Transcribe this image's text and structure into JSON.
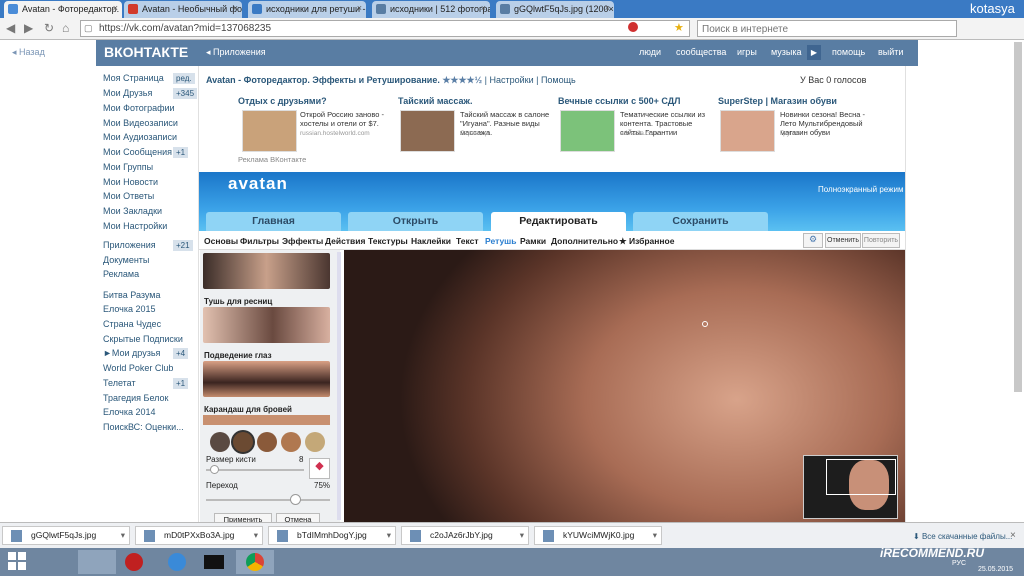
{
  "browser": {
    "tabs": [
      {
        "label": "Avatan - Фоторедактор. Э",
        "color": "#4a8cd8"
      },
      {
        "label": "Avatan - Необычный фот",
        "color": "#d23a2a"
      },
      {
        "label": "исходники для ретуши -",
        "color": "#3a7ac4"
      },
      {
        "label": "исходники | 512 фотогра",
        "color": "#597da3"
      },
      {
        "label": "gGQlwtF5qJs.jpg (1200×8",
        "color": "#597da3"
      }
    ],
    "user": "kotasya",
    "url": "https://vk.com/avatan?mid=137068235",
    "search_placeholder": "Поиск в интернете"
  },
  "vk": {
    "logo": "ВКОНТАКТЕ",
    "apps_crumb": "◂ Приложения",
    "menu": [
      "люди",
      "сообщества",
      "игры",
      "музыка",
      "помощь",
      "выйти"
    ],
    "back": "Назад",
    "left_menu": [
      {
        "label": "Моя Страница",
        "badge": "ред."
      },
      {
        "label": "Мои Друзья",
        "badge": "+345"
      },
      {
        "label": "Мои Фотографии",
        "badge": ""
      },
      {
        "label": "Мои Видеозаписи",
        "badge": ""
      },
      {
        "label": "Мои Аудиозаписи",
        "badge": ""
      },
      {
        "label": "Мои Сообщения",
        "badge": "+1"
      },
      {
        "label": "Мои Группы",
        "badge": ""
      },
      {
        "label": "Мои Новости",
        "badge": ""
      },
      {
        "label": "Мои Ответы",
        "badge": ""
      },
      {
        "label": "Мои Закладки",
        "badge": ""
      },
      {
        "label": "Мои Настройки",
        "badge": ""
      },
      {
        "label": "Приложения",
        "badge": "+21"
      },
      {
        "label": "Документы",
        "badge": ""
      },
      {
        "label": "Реклама",
        "badge": ""
      },
      {
        "label": "Битва Разума",
        "badge": ""
      },
      {
        "label": "Елочка 2015",
        "badge": ""
      },
      {
        "label": "Страна Чудес",
        "badge": ""
      },
      {
        "label": "Скрытые Подписки",
        "badge": ""
      },
      {
        "label": "►Мои друзья",
        "badge": "+4"
      },
      {
        "label": "World Poker Club",
        "badge": ""
      },
      {
        "label": "Телетат",
        "badge": "+1"
      },
      {
        "label": "Трагедия Белок",
        "badge": ""
      },
      {
        "label": "Елочка 2014",
        "badge": ""
      },
      {
        "label": "ПоискВС: Оценки...",
        "badge": ""
      }
    ]
  },
  "app": {
    "title": "Avatan - Фоторедактор. Эффекты и Ретуширование.",
    "rating": "★★★★½",
    "links": "| Настройки | Помощь",
    "votes": "У Вас 0 голосов"
  },
  "ads": [
    {
      "title": "Отдых с друзьями?",
      "text": "Открой Россию заново - хостелы и отели от $7.",
      "sub": "russian.hostelworld.com",
      "color": "#c9a27a"
    },
    {
      "title": "Тайский массаж.",
      "text": "Тайский массаж в салоне \"Игуана\". Разные виды массажа.",
      "sub": "Страница",
      "color": "#8c6a52"
    },
    {
      "title": "Вечные ссылки с 500+ СДЛ",
      "text": "Тематические ссылки из контента. Трастовые сайты. Гарантии",
      "sub": "advezlla.com",
      "color": "#7cc27a"
    },
    {
      "title": "SuperStep | Магазин обуви",
      "text": "Новинки сезона! Весна - Лето Мультибрендовый магазин обуви",
      "sub": "Группа",
      "color": "#d9a58c"
    }
  ],
  "ad_footer": "Реклама ВКонтакте",
  "avatan": {
    "logo": "avatan",
    "fullscreen": "Полноэкранный режим",
    "tabs": [
      "Главная",
      "Открыть",
      "Редактировать",
      "Сохранить"
    ],
    "subtabs": [
      "Основы",
      "Фильтры",
      "Эффекты",
      "Действия",
      "Текстуры",
      "Наклейки",
      "Текст",
      "Ретушь",
      "Рамки",
      "Дополнительно",
      "★ Избранное"
    ],
    "undo": "Отменить",
    "redo": "Повторить",
    "panel_items": [
      "Тушь для ресниц",
      "Подведение глаз",
      "Карандаш для бровей"
    ],
    "swatches": [
      "#5a4a42",
      "#6b4a32",
      "#8a5a3a",
      "#b07850",
      "#c4a878"
    ],
    "brush_label": "Размер кисти",
    "brush_value": "8",
    "transition_label": "Переход",
    "transition_value": "75%",
    "apply": "Применить",
    "cancel": "Отмена"
  },
  "downloads": {
    "files": [
      "gGQlwtF5qJs.jpg",
      "mD0tPXxBo3A.jpg",
      "bTdIMmhDogY.jpg",
      "c2oJAz6rJbY.jpg",
      "kYUWciMWjK0.jpg"
    ],
    "all": "Все скачанные файлы..."
  },
  "taskbar": {
    "lang": "РУС",
    "date": "25.05.2015",
    "watermark": "iRECOMMEND.RU"
  }
}
